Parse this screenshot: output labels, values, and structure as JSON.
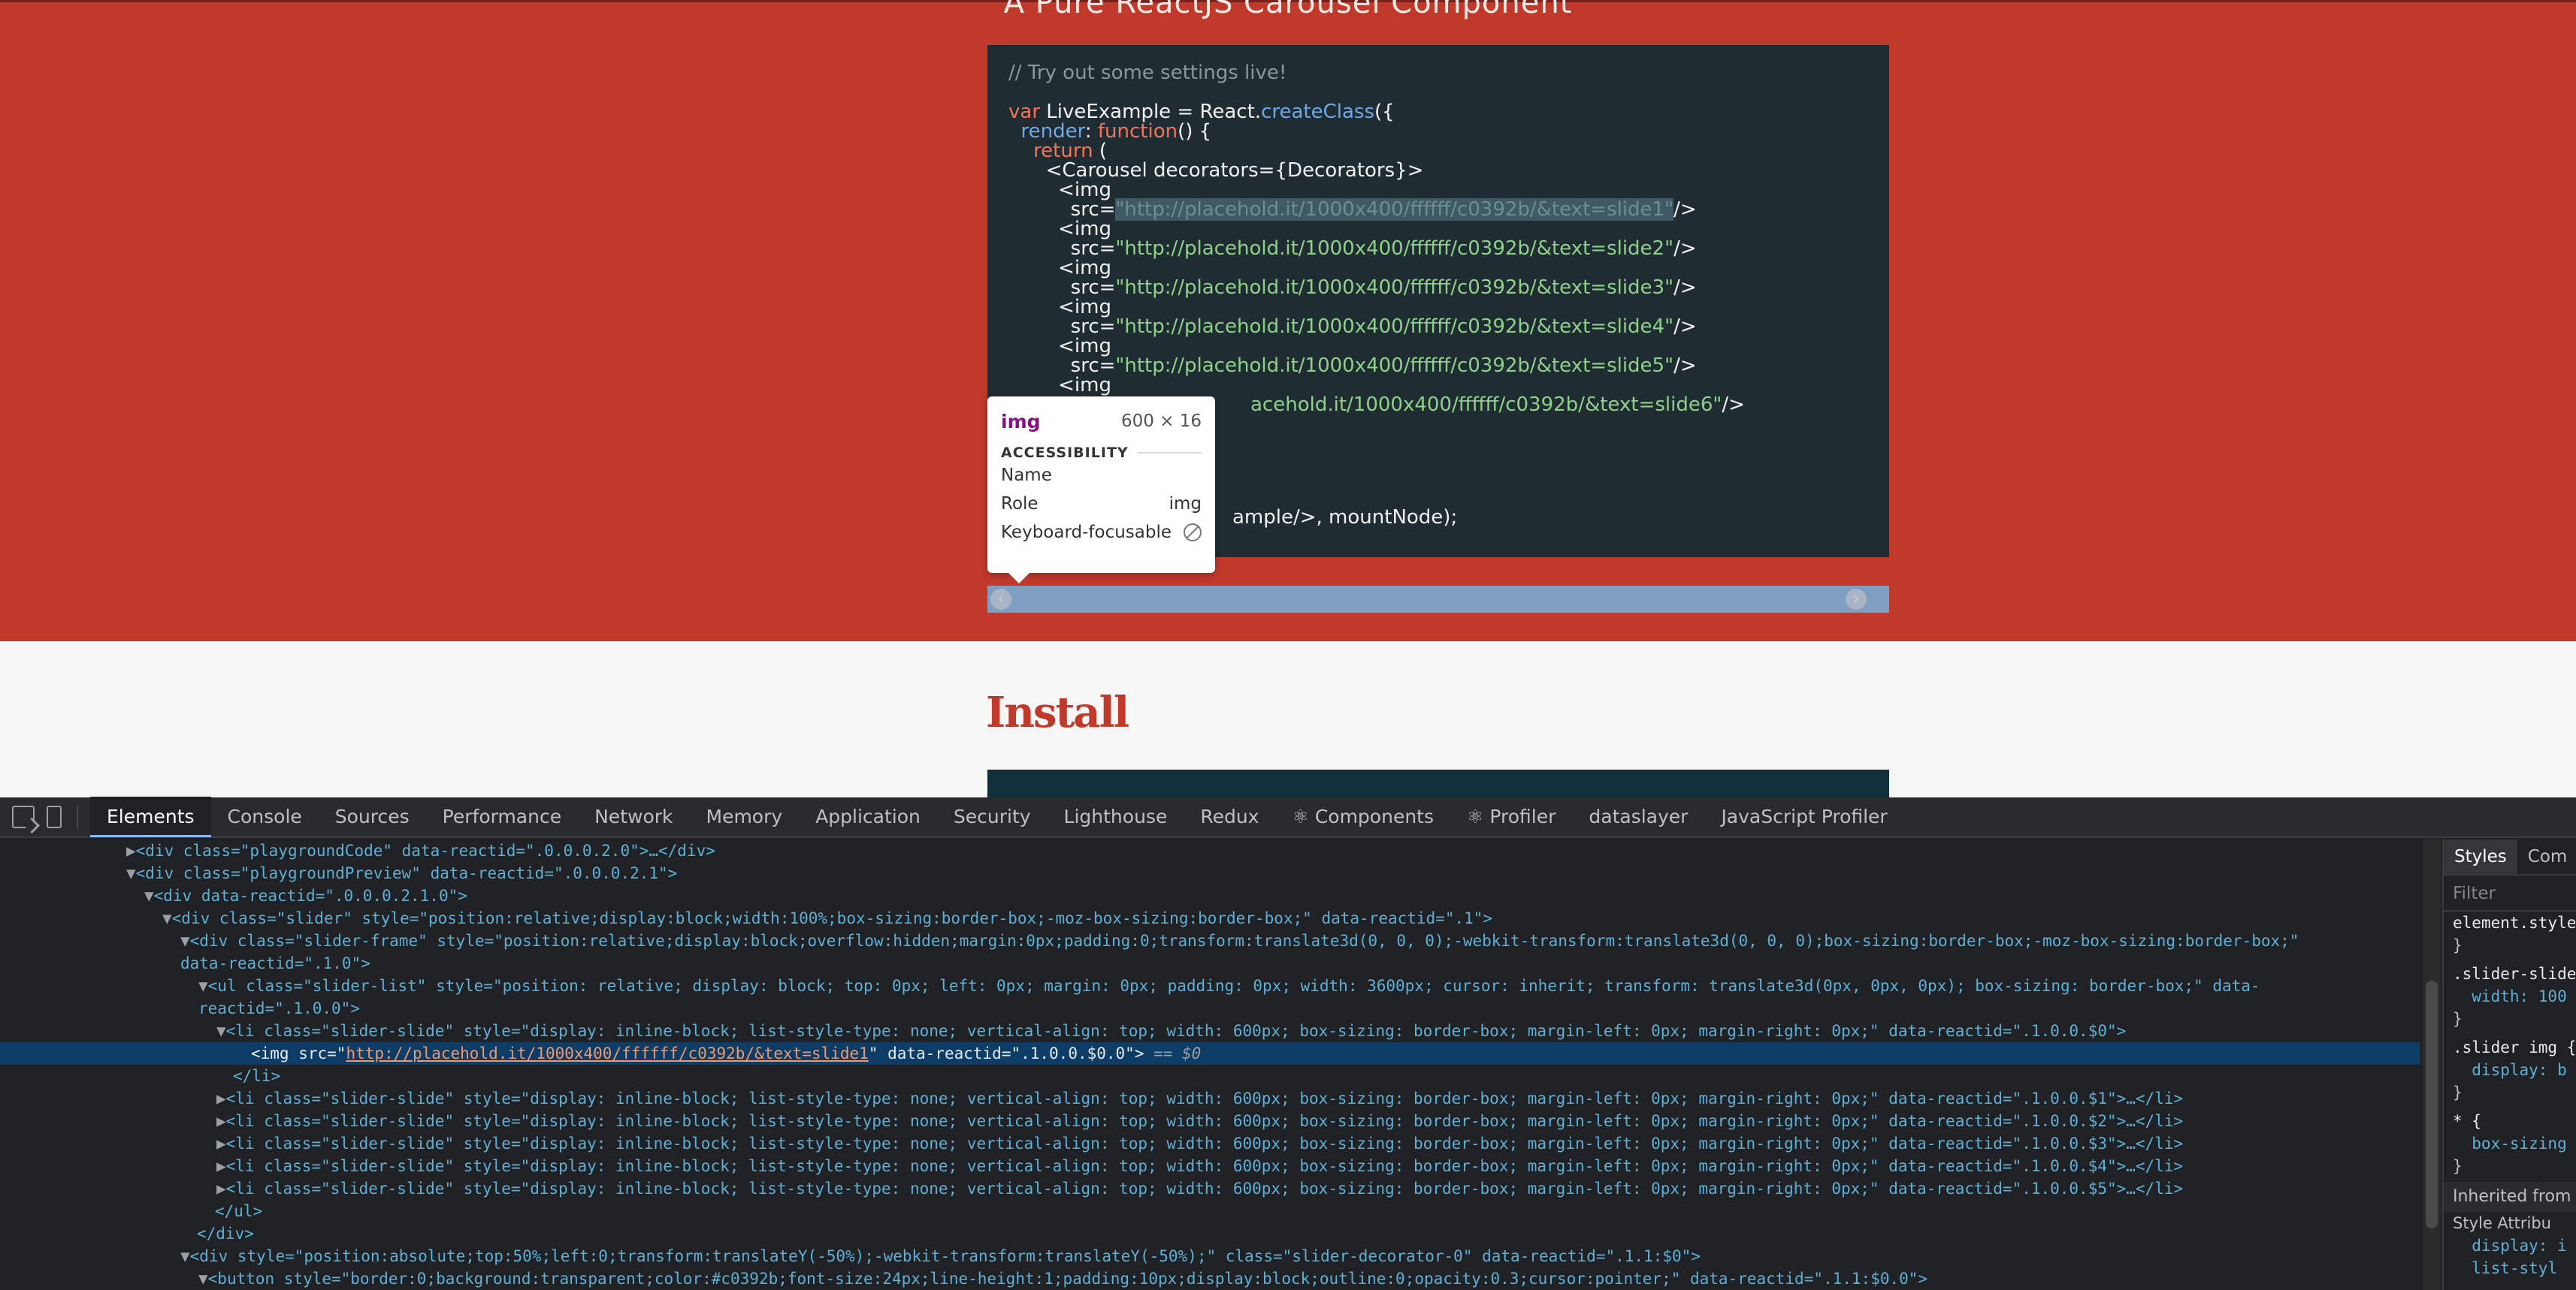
{
  "page": {
    "hero_title": "A Pure ReactJS Carousel Component",
    "install_heading": "Install"
  },
  "code": {
    "comment": "// Try out some settings live!",
    "l_var_kw": "var",
    "l_var_name": " LiveExample = React.",
    "l_var_fn": "createClass",
    "l_var_end": "({",
    "l_render_key": "render",
    "l_render_mid": ": ",
    "l_render_fn": "function",
    "l_render_end": "() {",
    "l_return_kw": "return",
    "l_return_end": " (",
    "l_carousel": "<Carousel decorators={Decorators}>",
    "img_open": "<img",
    "src_attr": "src=",
    "src1": "\"http://placehold.it/1000x400/ffffff/c0392b/&text=slide1\"",
    "src2": "\"http://placehold.it/1000x400/ffffff/c0392b/&text=slide2\"",
    "src3": "\"http://placehold.it/1000x400/ffffff/c0392b/&text=slide3\"",
    "src4": "\"http://placehold.it/1000x400/ffffff/c0392b/&text=slide4\"",
    "src5": "\"http://placehold.it/1000x400/ffffff/c0392b/&text=slide5\"",
    "src6_visible": "acehold.it/1000x400/ffffff/c0392b/&text=slide6\"",
    "img_close": "/>",
    "render_call_visible": "ample/>, mountNode);"
  },
  "tooltip": {
    "tag": "img",
    "size": "600 × 16",
    "section": "ACCESSIBILITY",
    "name_label": "Name",
    "role_label": "Role",
    "role_value": "img",
    "focus_label": "Keyboard-focusable"
  },
  "slider": {
    "prev_icon": "‹",
    "next_icon": "›"
  },
  "devtools": {
    "tabs": [
      "Elements",
      "Console",
      "Sources",
      "Performance",
      "Network",
      "Memory",
      "Application",
      "Security",
      "Lighthouse",
      "Redux",
      "⚛ Components",
      "⚛ Profiler",
      "dataslayer",
      "JavaScript Profiler"
    ],
    "dom": {
      "l0": "<div class=\"playgroundCode\" data-reactid=\".0.0.0.2.0\">…</div>",
      "l1": "<div class=\"playgroundPreview\" data-reactid=\".0.0.0.2.1\">",
      "l2": "<div data-reactid=\".0.0.0.2.1.0\">",
      "l3": "<div class=\"slider\" style=\"position:relative;display:block;width:100%;box-sizing:border-box;-moz-box-sizing:border-box;\" data-reactid=\".1\">",
      "l4a": "<div class=\"slider-frame\" style=\"position:relative;display:block;overflow:hidden;margin:0px;padding:0;transform:translate3d(0, 0, 0);-webkit-transform:translate3d(0, 0, 0);box-sizing:border-box;-moz-box-sizing:border-box;\"",
      "l4b": "data-reactid=\".1.0\">",
      "l5a": "<ul class=\"slider-list\" style=\"position: relative; display: block; top: 0px; left: 0px; margin: 0px; padding: 0px; width: 3600px; cursor: inherit; transform: translate3d(0px, 0px, 0px); box-sizing: border-box;\" data-",
      "l5b": "reactid=\".1.0.0\">",
      "l6": "<li class=\"slider-slide\" style=\"display: inline-block; list-style-type: none; vertical-align: top; width: 600px; box-sizing: border-box; margin-left: 0px; margin-right: 0px;\" data-reactid=\".1.0.0.$0\">",
      "l7_pre": "<img src=\"",
      "l7_url": "http://placehold.it/1000x400/ffffff/c0392b/&text=slide1",
      "l7_post": "\" data-reactid=\".1.0.0.$0.0\">",
      "l7_eq": " == $0",
      "l8": "</li>",
      "li1": "<li class=\"slider-slide\" style=\"display: inline-block; list-style-type: none; vertical-align: top; width: 600px; box-sizing: border-box; margin-left: 0px; margin-right: 0px;\" data-reactid=\".1.0.0.$1\">…</li>",
      "li2": "<li class=\"slider-slide\" style=\"display: inline-block; list-style-type: none; vertical-align: top; width: 600px; box-sizing: border-box; margin-left: 0px; margin-right: 0px;\" data-reactid=\".1.0.0.$2\">…</li>",
      "li3": "<li class=\"slider-slide\" style=\"display: inline-block; list-style-type: none; vertical-align: top; width: 600px; box-sizing: border-box; margin-left: 0px; margin-right: 0px;\" data-reactid=\".1.0.0.$3\">…</li>",
      "li4": "<li class=\"slider-slide\" style=\"display: inline-block; list-style-type: none; vertical-align: top; width: 600px; box-sizing: border-box; margin-left: 0px; margin-right: 0px;\" data-reactid=\".1.0.0.$4\">…</li>",
      "li5": "<li class=\"slider-slide\" style=\"display: inline-block; list-style-type: none; vertical-align: top; width: 600px; box-sizing: border-box; margin-left: 0px; margin-right: 0px;\" data-reactid=\".1.0.0.$5\">…</li>",
      "ul_close": "</ul>",
      "div_close": "</div>",
      "dec": "<div style=\"position:absolute;top:50%;left:0;transform:translateY(-50%);-webkit-transform:translateY(-50%);\" class=\"slider-decorator-0\" data-reactid=\".1.1:$0\">",
      "btn": "<button style=\"border:0;background:transparent;color:#c0392b;font-size:24px;line-height:1;padding:10px;display:block;outline:0;opacity:0.3;cursor:pointer;\" data-reactid=\".1.1:$0.0\">"
    },
    "styles": {
      "tab_styles": "Styles",
      "tab_computed": "Com",
      "filter_placeholder": "Filter",
      "element_style": "element.style",
      "close_brace": "}",
      "rule1_sel": ".slider-slide",
      "rule1_prop": "  width: 100",
      "rule2_sel": ".slider img {",
      "rule2_prop": "  display: b",
      "rule3_sel": "* {",
      "rule3_prop": "  box-sizing",
      "inherited": "Inherited from",
      "style_attr": "Style Attribu",
      "style_attr_prop": "  display: i",
      "style_attr_prop2": "  list-styl"
    }
  }
}
